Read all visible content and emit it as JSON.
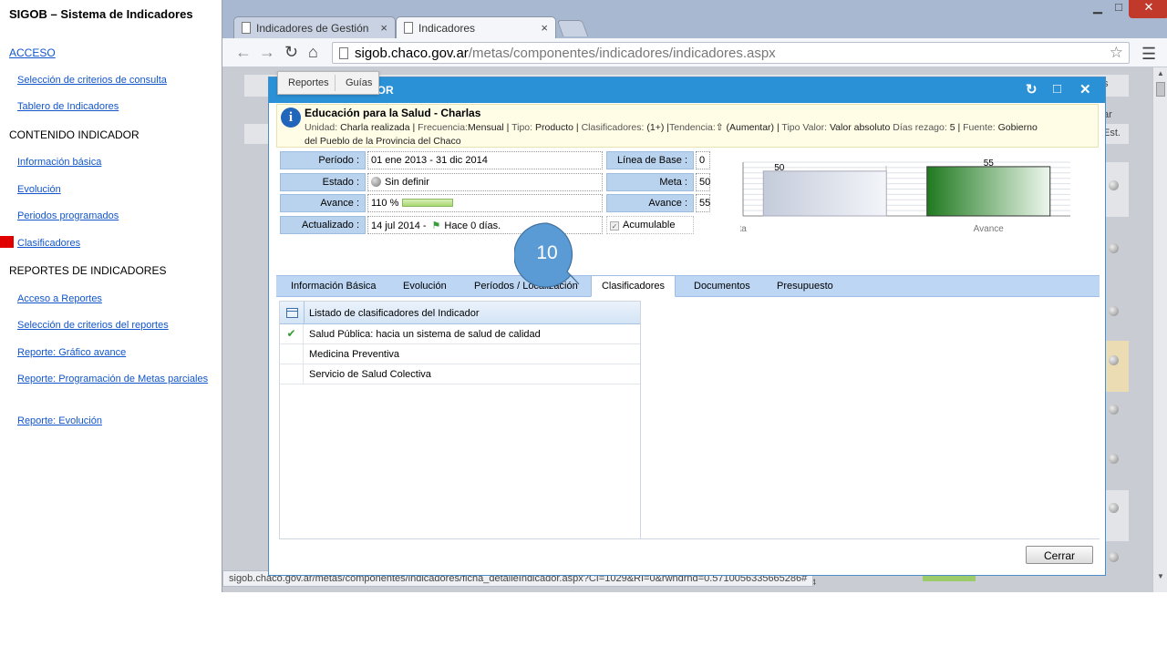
{
  "sidebar": {
    "app_title": "SIGOB – Sistema de Indicadores",
    "sections": [
      {
        "label": "ACCESO"
      },
      {
        "label": "CONTENIDO INDICADOR"
      },
      {
        "label": "REPORTES DE INDICADORES"
      }
    ],
    "items": [
      "Selección de criterios de consulta",
      "Tablero de Indicadores",
      "Información básica",
      "Evolución",
      "Periodos programados",
      "Clasificadores",
      "Acceso a Reportes",
      "Selección de criterios del reportes",
      "Reporte: Gráfico avance",
      "Reporte: Programación de Metas parciales",
      "Reporte: Evolución"
    ]
  },
  "browser": {
    "tabs": [
      {
        "label": "Indicadores de Gestión",
        "close": "×"
      },
      {
        "label": "Indicadores",
        "close": "×"
      }
    ],
    "url_host": "sigob.chaco.gov.ar",
    "url_path": "/metas/componentes/indicadores/indicadores.aspx",
    "status_url": "sigob.chaco.gov.ar/metas/componentes/indicadores/ficha_detalleIndicador.aspx?CI=1029&RI=0&rwndrnd=0.5710056335665286#"
  },
  "popup_menu": {
    "reportes": "Reportes",
    "guias": "Guías"
  },
  "modal": {
    "header_title": "DOR",
    "indicator_title": "Educación para la Salud - Charlas",
    "meta_line1": {
      "unidad_lbl": "Unidad:",
      "unidad": "Charla realizada",
      "frecuencia_lbl": "Frecuencia:",
      "frecuencia": "Mensual",
      "tipo_lbl": "Tipo:",
      "tipo": "Producto",
      "clasif_lbl": "Clasificadores:",
      "clasif": "(1+)",
      "tendencia_lbl": "Tendencia:",
      "tendencia": "(Aumentar)",
      "tipo_valor_lbl": "Tipo Valor:",
      "tipo_valor": "Valor absoluto",
      "dias_lbl": "Días rezago:",
      "dias": "5",
      "fuente_lbl": "Fuente:",
      "fuente": "Gobierno"
    },
    "meta_line2": "del Pueblo de la Provincia del Chaco",
    "fields": {
      "periodo_lbl": "Período :",
      "periodo": "01 ene 2013 - 31 dic 2014",
      "estado_lbl": "Estado :",
      "estado": "Sin definir",
      "avance_lbl": "Avance :",
      "avance": "110 %",
      "actualizado_lbl": "Actualizado :",
      "actualizado": "14 jul 2014 -",
      "hace": "Hace 0 días.",
      "linea_base_lbl": "Línea de Base :",
      "linea_base": "0",
      "meta_lbl": "Meta :",
      "meta": "50",
      "avance2_lbl": "Avance :",
      "avance2": "55",
      "acumulable": "Acumulable"
    },
    "detail_tabs": [
      "Información Básica",
      "Evolución",
      "Períodos / Localización",
      "Clasificadores",
      "Documentos",
      "Presupuesto"
    ],
    "active_tab": "Clasificadores",
    "clasificadores": {
      "header": "Listado de clasificadores del Indicador",
      "rows": [
        {
          "label": "Salud Pública: hacia un sistema de salud de calidad",
          "checked": true
        },
        {
          "label": "Medicina Preventiva",
          "checked": false
        },
        {
          "label": "Servicio de Salud Colectiva",
          "checked": false
        }
      ]
    },
    "close_button": "Cerrar"
  },
  "chart_data": {
    "type": "bar",
    "categories": [
      "Meta",
      "Avance"
    ],
    "values": [
      50,
      55
    ],
    "value_labels": [
      "50",
      "55"
    ],
    "ylim": [
      0,
      60
    ],
    "grid": true,
    "colors": [
      "#d6dbe6",
      "#2e8b2e"
    ]
  },
  "callout": {
    "label": "10",
    "color": "#5b9bd5"
  },
  "background_fragments": {
    "ar": "ar",
    "est": "Est.",
    "s": "s",
    "num": "44"
  }
}
